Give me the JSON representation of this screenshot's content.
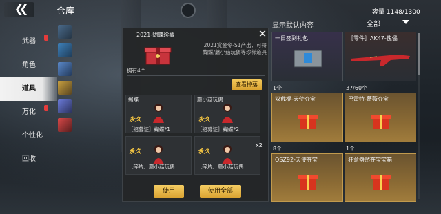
{
  "header": {
    "title": "仓库",
    "capacity_label": "容量",
    "capacity_value": "1148/1300"
  },
  "nav": {
    "items": [
      {
        "label": "武器",
        "active": false,
        "badge": true
      },
      {
        "label": "角色",
        "active": false,
        "badge": false
      },
      {
        "label": "道具",
        "active": true,
        "badge": false
      },
      {
        "label": "万化",
        "active": false,
        "badge": true
      },
      {
        "label": "个性化",
        "active": false,
        "badge": false
      },
      {
        "label": "回收",
        "active": false,
        "badge": false
      }
    ]
  },
  "popup": {
    "title": "2021-蝴蝶珍藏",
    "description_line1": "2021赏金令-S1产出，可得",
    "description_line2": "蝴蝶/蘑小菇玩偶等珍稀道具",
    "owned": "拥有4个",
    "view_button": "查看掉落",
    "items": [
      {
        "name": "蝴蝶",
        "perm": "永久",
        "tag": "［招募证］蝴蝶*1",
        "count": ""
      },
      {
        "name": "蘑小菇玩偶",
        "perm": "永久",
        "tag": "［招募证］蝴蝶*2",
        "count": ""
      },
      {
        "name": "",
        "perm": "永久",
        "tag": "［碎片］蘑小菇玩偶",
        "count": ""
      },
      {
        "name": "",
        "perm": "永久",
        "tag": "［碎片］蘑小菇玩偶",
        "count": "x2"
      }
    ],
    "use_button": "使用",
    "use_all_button": "使用全部"
  },
  "panel": {
    "filter_label": "显示默认内容",
    "filter_value": "全部",
    "cards": [
      {
        "name": "一日签到礼包",
        "count": ""
      },
      {
        "name": "［零件］AK47-傀儡",
        "count": ""
      },
      {
        "name": "双截棍-天使夺宝",
        "count": "1个"
      },
      {
        "name": "巴雷特-蔷薇夺宝",
        "count": "37/60个"
      },
      {
        "name": "QSZ92-天使夺宝",
        "count": "8个"
      },
      {
        "name": "狂意盎然夺宝宝箱",
        "count": "1个"
      }
    ]
  },
  "colors": {
    "accent_gold": "#f3c85a",
    "badge_red": "#e53b3b",
    "active_nav_bg": "#f0f0f0"
  }
}
